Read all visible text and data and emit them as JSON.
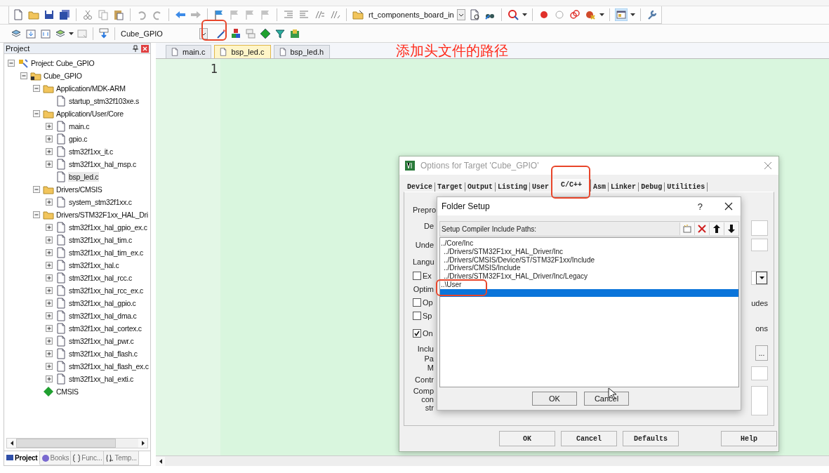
{
  "toolbar": {
    "file_combo": "rt_components_board_in"
  },
  "build_toolbar": {
    "target": "Cube_GPIO"
  },
  "annotation": "添加头文件的路径",
  "project_panel": {
    "title": "Project",
    "tree": [
      {
        "label": "Project: Cube_GPIO",
        "kind": "project",
        "expanded": true,
        "selected": false,
        "children": [
          {
            "label": "Cube_GPIO",
            "kind": "target",
            "expanded": true,
            "selected": false,
            "children": [
              {
                "label": "Application/MDK-ARM",
                "kind": "group",
                "expanded": true,
                "selected": false,
                "children": [
                  {
                    "label": "startup_stm32f103xe.s",
                    "kind": "file",
                    "selected": false
                  }
                ]
              },
              {
                "label": "Application/User/Core",
                "kind": "group",
                "expanded": true,
                "selected": false,
                "children": [
                  {
                    "label": "main.c",
                    "kind": "file",
                    "expanded": false,
                    "selected": false
                  },
                  {
                    "label": "gpio.c",
                    "kind": "file",
                    "expanded": false,
                    "selected": false
                  },
                  {
                    "label": "stm32f1xx_it.c",
                    "kind": "file",
                    "expanded": false,
                    "selected": false
                  },
                  {
                    "label": "stm32f1xx_hal_msp.c",
                    "kind": "file",
                    "expanded": false,
                    "selected": false
                  },
                  {
                    "label": "bsp_led.c",
                    "kind": "file",
                    "selected": true
                  }
                ]
              },
              {
                "label": "Drivers/CMSIS",
                "kind": "group",
                "expanded": true,
                "selected": false,
                "children": [
                  {
                    "label": "system_stm32f1xx.c",
                    "kind": "file",
                    "expanded": false,
                    "selected": false
                  }
                ]
              },
              {
                "label": "Drivers/STM32F1xx_HAL_Dri",
                "kind": "group",
                "expanded": true,
                "selected": false,
                "children": [
                  {
                    "label": "stm32f1xx_hal_gpio_ex.c",
                    "kind": "file",
                    "expanded": false,
                    "selected": false
                  },
                  {
                    "label": "stm32f1xx_hal_tim.c",
                    "kind": "file",
                    "expanded": false,
                    "selected": false
                  },
                  {
                    "label": "stm32f1xx_hal_tim_ex.c",
                    "kind": "file",
                    "expanded": false,
                    "selected": false
                  },
                  {
                    "label": "stm32f1xx_hal.c",
                    "kind": "file",
                    "expanded": false,
                    "selected": false
                  },
                  {
                    "label": "stm32f1xx_hal_rcc.c",
                    "kind": "file",
                    "expanded": false,
                    "selected": false
                  },
                  {
                    "label": "stm32f1xx_hal_rcc_ex.c",
                    "kind": "file",
                    "expanded": false,
                    "selected": false
                  },
                  {
                    "label": "stm32f1xx_hal_gpio.c",
                    "kind": "file",
                    "expanded": false,
                    "selected": false
                  },
                  {
                    "label": "stm32f1xx_hal_dma.c",
                    "kind": "file",
                    "expanded": false,
                    "selected": false
                  },
                  {
                    "label": "stm32f1xx_hal_cortex.c",
                    "kind": "file",
                    "expanded": false,
                    "selected": false
                  },
                  {
                    "label": "stm32f1xx_hal_pwr.c",
                    "kind": "file",
                    "expanded": false,
                    "selected": false
                  },
                  {
                    "label": "stm32f1xx_hal_flash.c",
                    "kind": "file",
                    "expanded": false,
                    "selected": false
                  },
                  {
                    "label": "stm32f1xx_hal_flash_ex.c",
                    "kind": "file",
                    "expanded": false,
                    "selected": false
                  },
                  {
                    "label": "stm32f1xx_hal_exti.c",
                    "kind": "file",
                    "expanded": false,
                    "selected": false
                  }
                ]
              },
              {
                "label": "CMSIS",
                "kind": "component",
                "selected": false
              }
            ]
          }
        ]
      }
    ],
    "bottom_tabs": [
      {
        "label": "Project",
        "selected": true
      },
      {
        "label": "Books",
        "selected": false
      },
      {
        "label": "Func...",
        "selected": false
      },
      {
        "label": "Temp...",
        "selected": false
      }
    ]
  },
  "editor": {
    "tabs": [
      {
        "label": "main.c",
        "selected": false
      },
      {
        "label": "bsp_led.c",
        "selected": true
      },
      {
        "label": "bsp_led.h",
        "selected": false
      }
    ],
    "line_numbers": [
      "1"
    ]
  },
  "options_dialog": {
    "title": "Options for Target 'Cube_GPIO'",
    "tabs": [
      {
        "label": "Device",
        "selected": false
      },
      {
        "label": "Target",
        "selected": false
      },
      {
        "label": "Output",
        "selected": false
      },
      {
        "label": "Listing",
        "selected": false
      },
      {
        "label": "User",
        "selected": false
      },
      {
        "label": "C/C++",
        "selected": true
      },
      {
        "label": "Asm",
        "selected": false
      },
      {
        "label": "Linker",
        "selected": false
      },
      {
        "label": "Debug",
        "selected": false
      },
      {
        "label": "Utilities",
        "selected": false
      }
    ],
    "left_items": [
      {
        "kind": "group",
        "text": "Prepro"
      },
      {
        "kind": "label",
        "text": "De"
      },
      {
        "kind": "label",
        "text": "Unde"
      },
      {
        "kind": "group",
        "text": "Langu"
      },
      {
        "kind": "checkbox",
        "text": "Ex",
        "checked": false
      },
      {
        "kind": "label",
        "text": "Optim"
      },
      {
        "kind": "checkbox",
        "text": "Op",
        "checked": false
      },
      {
        "kind": "checkbox",
        "text": "Sp",
        "checked": false
      },
      {
        "kind": "checkbox",
        "text": "On",
        "checked": true
      },
      {
        "kind": "label",
        "text": "Inclu"
      },
      {
        "kind": "label",
        "text": "Pa"
      },
      {
        "kind": "label",
        "text": "M"
      },
      {
        "kind": "label",
        "text": "Contr"
      },
      {
        "kind": "label",
        "text": "Comp"
      },
      {
        "kind": "label",
        "text": "con"
      },
      {
        "kind": "label",
        "text": "str"
      }
    ],
    "right_fragments": [
      "udes",
      "ons"
    ],
    "browse_button": "...",
    "buttons": [
      "OK",
      "Cancel",
      "Defaults",
      "Help"
    ]
  },
  "folder_dialog": {
    "title": "Folder Setup",
    "help": "?",
    "header": "Setup Compiler Include Paths:",
    "paths": [
      {
        "text": "../Core/Inc",
        "selected": false
      },
      {
        "text": "../Drivers/STM32F1xx_HAL_Driver/Inc",
        "selected": false
      },
      {
        "text": "../Drivers/CMSIS/Device/ST/STM32F1xx/Include",
        "selected": false
      },
      {
        "text": "../Drivers/CMSIS/Include",
        "selected": false
      },
      {
        "text": "../Drivers/STM32F1xx_HAL_Driver/Inc/Legacy",
        "selected": false
      },
      {
        "text": "..\\User",
        "selected": false
      }
    ],
    "new_entry": {
      "selected": true
    },
    "buttons": [
      "OK",
      "Cancel"
    ]
  }
}
